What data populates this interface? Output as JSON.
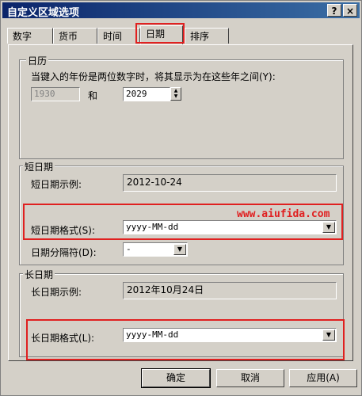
{
  "window": {
    "title": "自定义区域选项",
    "help_glyph": "?",
    "close_glyph": "×"
  },
  "tabs": [
    {
      "label": "数字"
    },
    {
      "label": "货币"
    },
    {
      "label": "时间"
    },
    {
      "label": "日期"
    },
    {
      "label": "排序"
    }
  ],
  "calendar": {
    "group_title": "日历",
    "description": "当键入的年份是两位数字时，将其显示为在这些年之间(Y):",
    "start_year": "1930",
    "and_label": "和",
    "end_year": "2029"
  },
  "short_date": {
    "group_title": "短日期",
    "sample_label": "短日期示例:",
    "sample_value": "2012-10-24",
    "format_label": "短日期格式(S):",
    "format_value": "yyyy-MM-dd",
    "separator_label": "日期分隔符(D):",
    "separator_value": "-"
  },
  "long_date": {
    "group_title": "长日期",
    "sample_label": "长日期示例:",
    "sample_value": "2012年10月24日",
    "format_label": "长日期格式(L):",
    "format_value": "yyyy-MM-dd"
  },
  "watermark": "www.aiufida.com",
  "buttons": {
    "ok": "确定",
    "cancel": "取消",
    "apply": "应用(A)"
  },
  "colors": {
    "highlight": "#e02020",
    "title_bar": "#0a246a"
  }
}
